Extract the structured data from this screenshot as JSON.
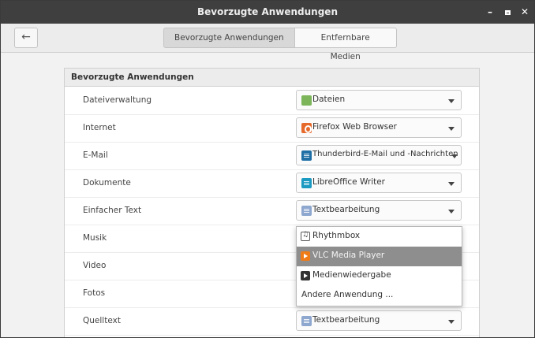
{
  "window": {
    "title": "Bevorzugte Anwendungen",
    "minimize_label": "–",
    "close_label": "✕"
  },
  "toolbar": {
    "back_label": "←",
    "tabs": [
      {
        "label": "Bevorzugte Anwendungen",
        "active": true
      },
      {
        "label": "Entfernbare Medien",
        "active": false
      }
    ]
  },
  "panel": {
    "header": "Bevorzugte Anwendungen",
    "rows": [
      {
        "label": "Dateiverwaltung",
        "value": "Dateien",
        "icon": "folder-icon"
      },
      {
        "label": "Internet",
        "value": "Firefox Web Browser",
        "icon": "firefox-icon"
      },
      {
        "label": "E-Mail",
        "value": "Thunderbird-E-Mail und -Nachrichten",
        "icon": "thunderbird-icon"
      },
      {
        "label": "Dokumente",
        "value": "LibreOffice Writer",
        "icon": "libreoffice-writer-icon"
      },
      {
        "label": "Einfacher Text",
        "value": "Textbearbeitung",
        "icon": "text-editor-icon"
      },
      {
        "label": "Musik",
        "value": "",
        "icon": ""
      },
      {
        "label": "Video",
        "value": "",
        "icon": ""
      },
      {
        "label": "Fotos",
        "value": "",
        "icon": ""
      },
      {
        "label": "Quelltext",
        "value": "Textbearbeitung",
        "icon": "text-editor-icon"
      }
    ]
  },
  "dropdown": {
    "items": [
      {
        "label": "Rhythmbox",
        "icon": "rhythmbox-icon",
        "selected": false
      },
      {
        "label": "VLC Media Player",
        "icon": "vlc-icon",
        "selected": true
      },
      {
        "label": "Medienwiedergabe",
        "icon": "media-player-icon",
        "selected": false
      },
      {
        "label": "Andere Anwendung ...",
        "icon": "",
        "selected": false
      }
    ]
  },
  "colors": {
    "titlebar": "#3f3f3f",
    "selection": "#8e8e8e",
    "folder": "#7cb55a",
    "firefox": "#e66a2c",
    "vlc": "#f07c18"
  }
}
